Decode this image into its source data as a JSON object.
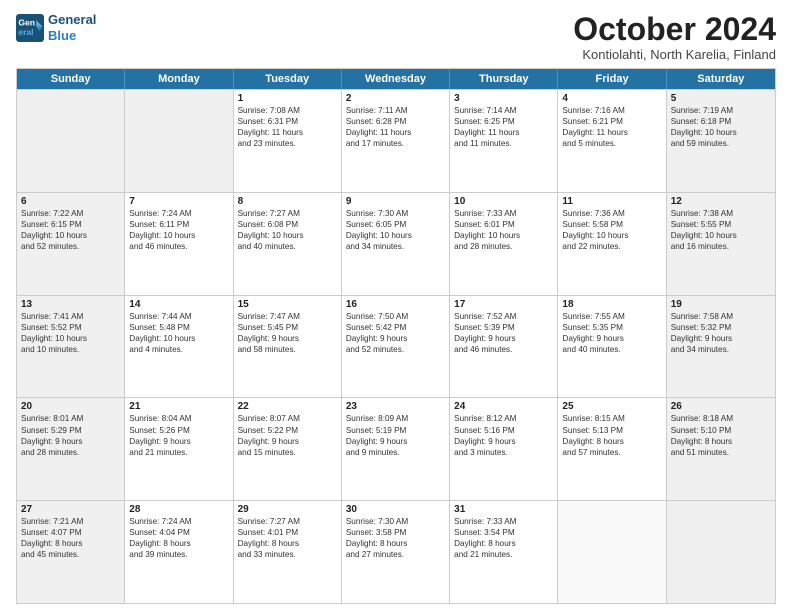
{
  "header": {
    "logo_line1": "General",
    "logo_line2": "Blue",
    "month": "October 2024",
    "location": "Kontiolahti, North Karelia, Finland"
  },
  "weekdays": [
    "Sunday",
    "Monday",
    "Tuesday",
    "Wednesday",
    "Thursday",
    "Friday",
    "Saturday"
  ],
  "weeks": [
    [
      {
        "day": "",
        "lines": [],
        "shaded": true
      },
      {
        "day": "",
        "lines": [],
        "shaded": true
      },
      {
        "day": "1",
        "lines": [
          "Sunrise: 7:08 AM",
          "Sunset: 6:31 PM",
          "Daylight: 11 hours",
          "and 23 minutes."
        ],
        "shaded": false
      },
      {
        "day": "2",
        "lines": [
          "Sunrise: 7:11 AM",
          "Sunset: 6:28 PM",
          "Daylight: 11 hours",
          "and 17 minutes."
        ],
        "shaded": false
      },
      {
        "day": "3",
        "lines": [
          "Sunrise: 7:14 AM",
          "Sunset: 6:25 PM",
          "Daylight: 11 hours",
          "and 11 minutes."
        ],
        "shaded": false
      },
      {
        "day": "4",
        "lines": [
          "Sunrise: 7:16 AM",
          "Sunset: 6:21 PM",
          "Daylight: 11 hours",
          "and 5 minutes."
        ],
        "shaded": false
      },
      {
        "day": "5",
        "lines": [
          "Sunrise: 7:19 AM",
          "Sunset: 6:18 PM",
          "Daylight: 10 hours",
          "and 59 minutes."
        ],
        "shaded": true
      }
    ],
    [
      {
        "day": "6",
        "lines": [
          "Sunrise: 7:22 AM",
          "Sunset: 6:15 PM",
          "Daylight: 10 hours",
          "and 52 minutes."
        ],
        "shaded": true
      },
      {
        "day": "7",
        "lines": [
          "Sunrise: 7:24 AM",
          "Sunset: 6:11 PM",
          "Daylight: 10 hours",
          "and 46 minutes."
        ],
        "shaded": false
      },
      {
        "day": "8",
        "lines": [
          "Sunrise: 7:27 AM",
          "Sunset: 6:08 PM",
          "Daylight: 10 hours",
          "and 40 minutes."
        ],
        "shaded": false
      },
      {
        "day": "9",
        "lines": [
          "Sunrise: 7:30 AM",
          "Sunset: 6:05 PM",
          "Daylight: 10 hours",
          "and 34 minutes."
        ],
        "shaded": false
      },
      {
        "day": "10",
        "lines": [
          "Sunrise: 7:33 AM",
          "Sunset: 6:01 PM",
          "Daylight: 10 hours",
          "and 28 minutes."
        ],
        "shaded": false
      },
      {
        "day": "11",
        "lines": [
          "Sunrise: 7:36 AM",
          "Sunset: 5:58 PM",
          "Daylight: 10 hours",
          "and 22 minutes."
        ],
        "shaded": false
      },
      {
        "day": "12",
        "lines": [
          "Sunrise: 7:38 AM",
          "Sunset: 5:55 PM",
          "Daylight: 10 hours",
          "and 16 minutes."
        ],
        "shaded": true
      }
    ],
    [
      {
        "day": "13",
        "lines": [
          "Sunrise: 7:41 AM",
          "Sunset: 5:52 PM",
          "Daylight: 10 hours",
          "and 10 minutes."
        ],
        "shaded": true
      },
      {
        "day": "14",
        "lines": [
          "Sunrise: 7:44 AM",
          "Sunset: 5:48 PM",
          "Daylight: 10 hours",
          "and 4 minutes."
        ],
        "shaded": false
      },
      {
        "day": "15",
        "lines": [
          "Sunrise: 7:47 AM",
          "Sunset: 5:45 PM",
          "Daylight: 9 hours",
          "and 58 minutes."
        ],
        "shaded": false
      },
      {
        "day": "16",
        "lines": [
          "Sunrise: 7:50 AM",
          "Sunset: 5:42 PM",
          "Daylight: 9 hours",
          "and 52 minutes."
        ],
        "shaded": false
      },
      {
        "day": "17",
        "lines": [
          "Sunrise: 7:52 AM",
          "Sunset: 5:39 PM",
          "Daylight: 9 hours",
          "and 46 minutes."
        ],
        "shaded": false
      },
      {
        "day": "18",
        "lines": [
          "Sunrise: 7:55 AM",
          "Sunset: 5:35 PM",
          "Daylight: 9 hours",
          "and 40 minutes."
        ],
        "shaded": false
      },
      {
        "day": "19",
        "lines": [
          "Sunrise: 7:58 AM",
          "Sunset: 5:32 PM",
          "Daylight: 9 hours",
          "and 34 minutes."
        ],
        "shaded": true
      }
    ],
    [
      {
        "day": "20",
        "lines": [
          "Sunrise: 8:01 AM",
          "Sunset: 5:29 PM",
          "Daylight: 9 hours",
          "and 28 minutes."
        ],
        "shaded": true
      },
      {
        "day": "21",
        "lines": [
          "Sunrise: 8:04 AM",
          "Sunset: 5:26 PM",
          "Daylight: 9 hours",
          "and 21 minutes."
        ],
        "shaded": false
      },
      {
        "day": "22",
        "lines": [
          "Sunrise: 8:07 AM",
          "Sunset: 5:22 PM",
          "Daylight: 9 hours",
          "and 15 minutes."
        ],
        "shaded": false
      },
      {
        "day": "23",
        "lines": [
          "Sunrise: 8:09 AM",
          "Sunset: 5:19 PM",
          "Daylight: 9 hours",
          "and 9 minutes."
        ],
        "shaded": false
      },
      {
        "day": "24",
        "lines": [
          "Sunrise: 8:12 AM",
          "Sunset: 5:16 PM",
          "Daylight: 9 hours",
          "and 3 minutes."
        ],
        "shaded": false
      },
      {
        "day": "25",
        "lines": [
          "Sunrise: 8:15 AM",
          "Sunset: 5:13 PM",
          "Daylight: 8 hours",
          "and 57 minutes."
        ],
        "shaded": false
      },
      {
        "day": "26",
        "lines": [
          "Sunrise: 8:18 AM",
          "Sunset: 5:10 PM",
          "Daylight: 8 hours",
          "and 51 minutes."
        ],
        "shaded": true
      }
    ],
    [
      {
        "day": "27",
        "lines": [
          "Sunrise: 7:21 AM",
          "Sunset: 4:07 PM",
          "Daylight: 8 hours",
          "and 45 minutes."
        ],
        "shaded": true
      },
      {
        "day": "28",
        "lines": [
          "Sunrise: 7:24 AM",
          "Sunset: 4:04 PM",
          "Daylight: 8 hours",
          "and 39 minutes."
        ],
        "shaded": false
      },
      {
        "day": "29",
        "lines": [
          "Sunrise: 7:27 AM",
          "Sunset: 4:01 PM",
          "Daylight: 8 hours",
          "and 33 minutes."
        ],
        "shaded": false
      },
      {
        "day": "30",
        "lines": [
          "Sunrise: 7:30 AM",
          "Sunset: 3:58 PM",
          "Daylight: 8 hours",
          "and 27 minutes."
        ],
        "shaded": false
      },
      {
        "day": "31",
        "lines": [
          "Sunrise: 7:33 AM",
          "Sunset: 3:54 PM",
          "Daylight: 8 hours",
          "and 21 minutes."
        ],
        "shaded": false
      },
      {
        "day": "",
        "lines": [],
        "shaded": false
      },
      {
        "day": "",
        "lines": [],
        "shaded": true
      }
    ]
  ]
}
